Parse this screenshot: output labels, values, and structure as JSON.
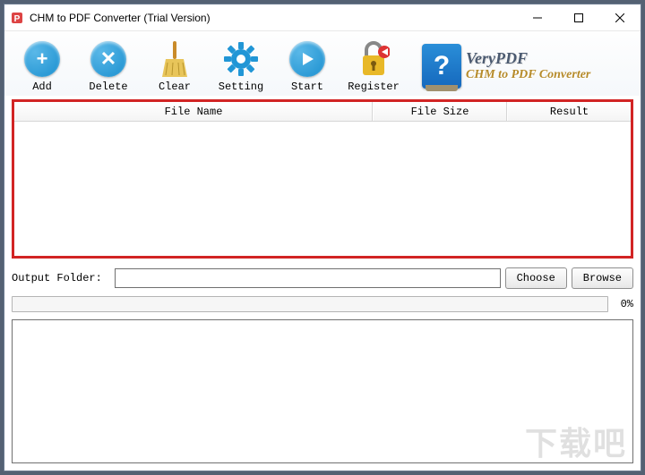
{
  "window": {
    "title": "CHM to PDF Converter (Trial Version)"
  },
  "toolbar": {
    "add": "Add",
    "delete": "Delete",
    "clear": "Clear",
    "setting": "Setting",
    "start": "Start",
    "register": "Register"
  },
  "brand": {
    "name": "VeryPDF",
    "tag": "CHM to PDF Converter"
  },
  "table": {
    "col_name": "File Name",
    "col_size": "File Size",
    "col_result": "Result",
    "rows": []
  },
  "output": {
    "label": "Output Folder:",
    "value": "",
    "choose": "Choose",
    "browse": "Browse"
  },
  "progress": {
    "percent": "0%"
  }
}
